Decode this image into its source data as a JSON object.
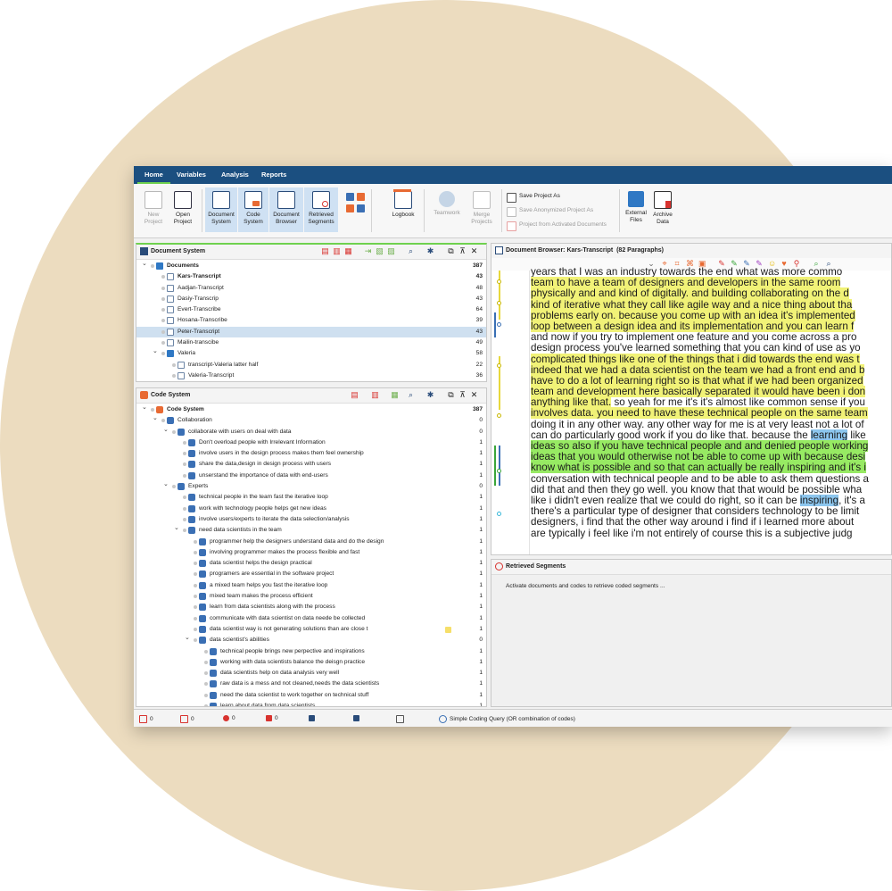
{
  "menu": {
    "tabs": [
      "Home",
      "Variables",
      "Analysis",
      "Reports"
    ],
    "active": "Home"
  },
  "ribbon": {
    "new_project": "New\nProject",
    "open_project": "Open\nProject",
    "document_system": "Document\nSystem",
    "code_system": "Code\nSystem",
    "document_browser": "Document\nBrowser",
    "retrieved_segments": "Retrieved\nSegments",
    "logbook": "Logbook",
    "teamwork": "Teamwork",
    "merge_projects": "Merge\nProjects",
    "save_project_as": "Save Project As",
    "save_anonymized": "Save Anonymized Project As",
    "project_from_activated": "Project from Activated Documents",
    "external_files": "External\nFiles",
    "archive_data": "Archive\nData"
  },
  "document_system": {
    "title": "Document System",
    "rows": [
      {
        "label": "Documents",
        "count": "387",
        "level": 0,
        "type": "folder",
        "expanded": true,
        "bold": true
      },
      {
        "label": "Kars-Transcript",
        "count": "43",
        "level": 1,
        "type": "doc",
        "bold": true
      },
      {
        "label": "Aadjan-Transcript",
        "count": "48",
        "level": 1,
        "type": "doc"
      },
      {
        "label": "Dasiy-Transcrip",
        "count": "43",
        "level": 1,
        "type": "doc"
      },
      {
        "label": "Evert-Transcribe",
        "count": "64",
        "level": 1,
        "type": "doc"
      },
      {
        "label": "Hosana-Transcribe",
        "count": "39",
        "level": 1,
        "type": "doc"
      },
      {
        "label": "Peter-Transcript",
        "count": "43",
        "level": 1,
        "type": "doc",
        "selected": true
      },
      {
        "label": "Mailin-transcibe",
        "count": "49",
        "level": 1,
        "type": "doc"
      },
      {
        "label": "Valeria",
        "count": "58",
        "level": 1,
        "type": "folder",
        "expanded": true
      },
      {
        "label": "transcript-Valeria latter half",
        "count": "22",
        "level": 2,
        "type": "doc"
      },
      {
        "label": "Valeria-Transcript",
        "count": "36",
        "level": 2,
        "type": "doc"
      }
    ]
  },
  "code_system": {
    "title": "Code System",
    "rows": [
      {
        "label": "Code System",
        "count": "387",
        "level": 0,
        "type": "codeset",
        "expanded": true,
        "bold": true
      },
      {
        "label": "Collaboration",
        "count": "0",
        "level": 1,
        "type": "code",
        "expanded": true
      },
      {
        "label": "collaborate with users on deal with data",
        "count": "0",
        "level": 2,
        "type": "code",
        "expanded": true
      },
      {
        "label": "Don't overload people with Irrelevant Information",
        "count": "1",
        "level": 3,
        "type": "code"
      },
      {
        "label": "involve users in the design process makes them feel ownership",
        "count": "1",
        "level": 3,
        "type": "code"
      },
      {
        "label": "share the data,design in design process with users",
        "count": "1",
        "level": 3,
        "type": "code"
      },
      {
        "label": "unserstand the importance of data with end-users",
        "count": "1",
        "level": 3,
        "type": "code"
      },
      {
        "label": "Experts",
        "count": "0",
        "level": 2,
        "type": "code",
        "expanded": true
      },
      {
        "label": "technical people in the team fast the iterative loop",
        "count": "1",
        "level": 3,
        "type": "code"
      },
      {
        "label": "work with technology people helps get new ideas",
        "count": "1",
        "level": 3,
        "type": "code"
      },
      {
        "label": "involve users/experts to iterate the data selection/analysis",
        "count": "1",
        "level": 3,
        "type": "code"
      },
      {
        "label": "need data scientists in the team",
        "count": "1",
        "level": 3,
        "type": "code",
        "expanded": true
      },
      {
        "label": "programmer help the designers understand data and do the design",
        "count": "1",
        "level": 4,
        "type": "code"
      },
      {
        "label": "involving programmer makes the process flexible and fast",
        "count": "1",
        "level": 4,
        "type": "code"
      },
      {
        "label": "data scientist helps the design practical",
        "count": "1",
        "level": 4,
        "type": "code"
      },
      {
        "label": "programers are essential in the software project",
        "count": "1",
        "level": 4,
        "type": "code"
      },
      {
        "label": "a mixed team helps you fast the iterative loop",
        "count": "1",
        "level": 4,
        "type": "code"
      },
      {
        "label": "mixed team makes the process efficient",
        "count": "1",
        "level": 4,
        "type": "code"
      },
      {
        "label": "learn from data scientists along with the process",
        "count": "1",
        "level": 4,
        "type": "code"
      },
      {
        "label": "communicate with data scientist on data neede be collected",
        "count": "1",
        "level": 4,
        "type": "code"
      },
      {
        "label": "data scientist way is not generating solutions than are close t",
        "count": "1",
        "level": 4,
        "type": "code",
        "memo": true
      },
      {
        "label": "data scientist's abilities",
        "count": "0",
        "level": 4,
        "type": "code",
        "expanded": true
      },
      {
        "label": "technical people brings new perpective and inspirations",
        "count": "1",
        "level": 5,
        "type": "code"
      },
      {
        "label": "working with data scientists balance the deisgn practice",
        "count": "1",
        "level": 5,
        "type": "code"
      },
      {
        "label": "data scientists help on data analysis very well",
        "count": "1",
        "level": 5,
        "type": "code"
      },
      {
        "label": "raw data is a mess and not cleaned,needs the data scientists",
        "count": "1",
        "level": 5,
        "type": "code"
      },
      {
        "label": "need the data scientist to work together on technical stuff",
        "count": "1",
        "level": 5,
        "type": "code"
      },
      {
        "label": "learn about data from data scientists",
        "count": "1",
        "level": 5,
        "type": "code"
      }
    ]
  },
  "document_browser": {
    "title": "Document Browser: Kars-Transcript",
    "paragraphs": "(82 Paragraphs)",
    "lines": [
      [
        {
          "t": "years that I was an industry towards the end what was more commo",
          "h": ""
        }
      ],
      [
        {
          "t": "team to have a team of designers and developers in the same room",
          "h": "y"
        }
      ],
      [
        {
          "t": "physically and and kind of digitally. and building collaborating on the d",
          "h": "y"
        }
      ],
      [
        {
          "t": "kind of iterative what they call like agile way and a nice thing about tha",
          "h": "y"
        }
      ],
      [
        {
          "t": "problems early on. because you come up with an idea it's implemented",
          "h": "y"
        }
      ],
      [
        {
          "t": "loop between a design idea and its implementation and you can learn f",
          "h": "y"
        }
      ],
      [
        {
          "t": "and now if you try to implement one feature and you come across a pro",
          "h": ""
        }
      ],
      [
        {
          "t": "design process you've learned something that you can kind of use as yo",
          "h": ""
        }
      ],
      [
        {
          "t": "complicated things like one of the things that i did towards the end was t",
          "h": "y"
        }
      ],
      [
        {
          "t": "indeed that we had a data scientist on the team we had a front end and b",
          "h": "y"
        }
      ],
      [
        {
          "t": "have to do a lot of learning right so is that what if we had been organized",
          "h": "y"
        }
      ],
      [
        {
          "t": "team and development here basically separated it would have been i don",
          "h": "y"
        }
      ],
      [
        {
          "t": "anything like that.",
          "h": "y"
        },
        {
          "t": " so yeah for me it's it's almost like common sense if you",
          "h": ""
        }
      ],
      [
        {
          "t": "involves data. you need to have these technical people on the same team",
          "h": "y"
        }
      ],
      [
        {
          "t": "doing it in any other way. any other way for me is at very least not a lot of",
          "h": ""
        }
      ],
      [
        {
          "t": "can do particularly good work if you do like that. because the ",
          "h": ""
        },
        {
          "t": "learning",
          "h": "b"
        },
        {
          "t": " like",
          "h": ""
        }
      ],
      [
        {
          "t": "ideas so also if you have technical people and and denied people working",
          "h": "g"
        }
      ],
      [
        {
          "t": "ideas that you would otherwise not be able to come up with because desi",
          "h": "g"
        }
      ],
      [
        {
          "t": "know what is possible and so that can actually be really inspiring and it's i",
          "h": "g"
        }
      ],
      [
        {
          "t": "conversation with technical people and to be able to ask them questions a",
          "h": ""
        }
      ],
      [
        {
          "t": "did that and then they go well. you know that that would be possible wha",
          "h": ""
        }
      ],
      [
        {
          "t": "like i didn't even realize that we could do right, so it can be ",
          "h": ""
        },
        {
          "t": "inspiring",
          "h": "b"
        },
        {
          "t": ", it's a",
          "h": ""
        }
      ],
      [
        {
          "t": "there's a particular type of designer that considers technology to be limit",
          "h": ""
        }
      ],
      [
        {
          "t": "designers, i find that the other way around i find  if i learned more about",
          "h": ""
        }
      ],
      [
        {
          "t": "are typically i feel like i'm not entirely of course this is a subjective judg",
          "h": ""
        }
      ]
    ]
  },
  "retrieved_segments": {
    "title": "Retrieved Segments",
    "message": "Activate documents and codes to retrieve coded segments ..."
  },
  "statusbar": {
    "items": [
      "0",
      "0",
      "0",
      "0",
      "",
      "",
      ""
    ],
    "query": "Simple Coding Query (OR combination of codes)"
  },
  "colors": {
    "menubar": "#1b4f80",
    "accent_green": "#6fd14f",
    "highlight_yellow": "#f1f277",
    "highlight_green": "#97ea63",
    "highlight_blue": "#8cc6ee",
    "background": "#ecdcbf"
  }
}
